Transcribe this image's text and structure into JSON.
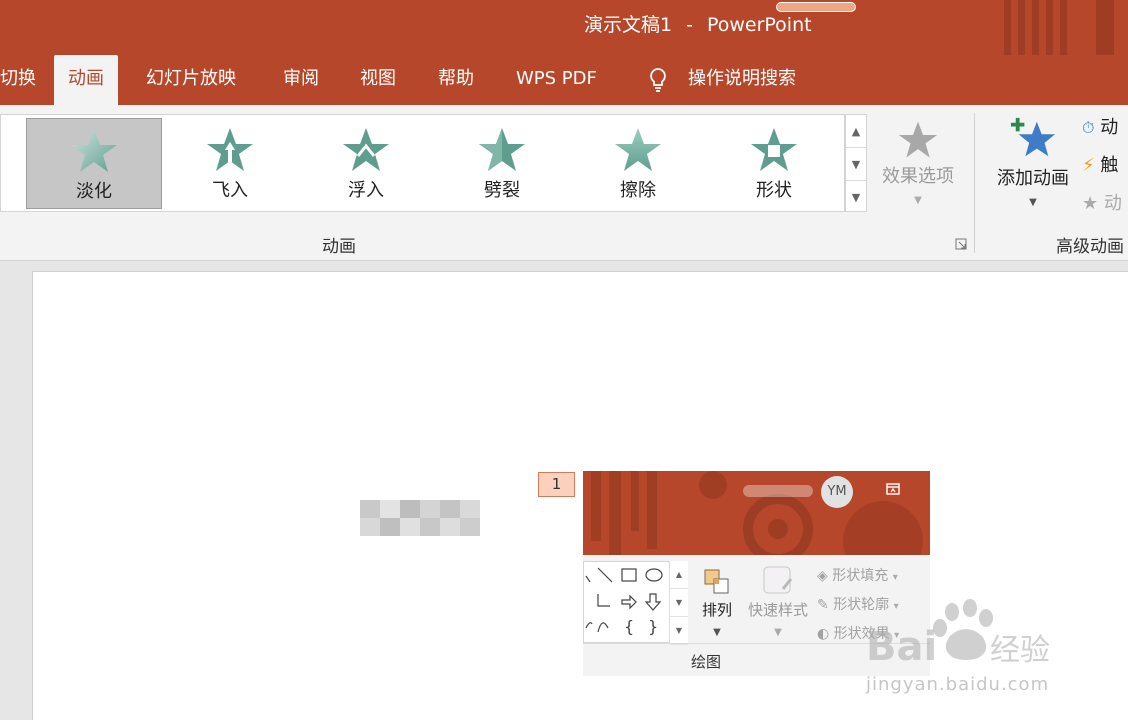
{
  "window": {
    "title_doc": "演示文稿1",
    "title_sep": "-",
    "title_app": "PowerPoint"
  },
  "tabs": [
    {
      "label": "切换"
    },
    {
      "label": "动画",
      "active": true
    },
    {
      "label": "幻灯片放映"
    },
    {
      "label": "审阅"
    },
    {
      "label": "视图"
    },
    {
      "label": "帮助"
    },
    {
      "label": "WPS PDF"
    },
    {
      "label": "操作说明搜索"
    }
  ],
  "animations": {
    "items": [
      {
        "label": "淡化",
        "icon": "fade-star-icon",
        "selected": true
      },
      {
        "label": "飞入",
        "icon": "fly-in-star-icon"
      },
      {
        "label": "浮入",
        "icon": "float-in-star-icon"
      },
      {
        "label": "劈裂",
        "icon": "split-star-icon"
      },
      {
        "label": "擦除",
        "icon": "wipe-star-icon"
      },
      {
        "label": "形状",
        "icon": "shape-star-icon"
      }
    ],
    "effect_options": "效果选项",
    "group_label": "动画"
  },
  "advanced": {
    "add_animation": "添加动画",
    "rows": [
      "动",
      "触",
      "动"
    ],
    "group_label": "高级动画"
  },
  "slide": {
    "animation_tag": "1",
    "picture": {
      "avatar": "YM",
      "arrange": "排列",
      "quick_styles": "快速样式",
      "shape_fill": "形状填充",
      "shape_outline": "形状轮廓",
      "shape_effects": "形状效果",
      "group_label": "绘图"
    }
  },
  "watermark": {
    "text": "jingyan.baidu.com",
    "brand": "Bai",
    "brand_cn": "经验"
  },
  "colors": {
    "accent": "#b7472a",
    "star_green": "#5f9e8f",
    "star_blue": "#3e7cc8",
    "tag_fill": "#fbd1bd"
  }
}
